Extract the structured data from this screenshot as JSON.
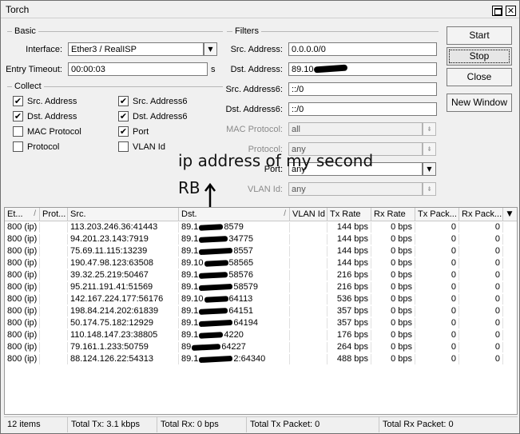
{
  "window": {
    "title": "Torch"
  },
  "basic": {
    "title": "Basic",
    "interface_label": "Interface:",
    "interface_value": "Ether3 / RealISP",
    "timeout_label": "Entry Timeout:",
    "timeout_value": "00:00:03",
    "timeout_unit": "s"
  },
  "collect": {
    "title": "Collect",
    "items": [
      {
        "label": "Src. Address",
        "checked": true
      },
      {
        "label": "Src. Address6",
        "checked": true
      },
      {
        "label": "Dst. Address",
        "checked": true
      },
      {
        "label": "Dst. Address6",
        "checked": true
      },
      {
        "label": "MAC Protocol",
        "checked": false
      },
      {
        "label": "Port",
        "checked": true
      },
      {
        "label": "Protocol",
        "checked": false
      },
      {
        "label": "VLAN Id",
        "checked": false
      }
    ],
    "check_mark": "✔"
  },
  "filters": {
    "title": "Filters",
    "src_label": "Src. Address:",
    "src_value": "0.0.0.0/0",
    "dst_label": "Dst. Address:",
    "dst_value": "89.10",
    "src6_label": "Src. Address6:",
    "src6_value": "::/0",
    "dst6_label": "Dst. Address6:",
    "dst6_value": "::/0",
    "mac_label": "MAC Protocol:",
    "mac_value": "all",
    "protocol_label": "Protocol:",
    "protocol_value": "any",
    "port_label": "Port:",
    "port_value": "any",
    "vlan_label": "VLAN Id:",
    "vlan_value": "any"
  },
  "buttons": {
    "start": "Start",
    "stop": "Stop",
    "close": "Close",
    "new_window": "New Window"
  },
  "annotation": {
    "line1": "ip address of my second",
    "line2": "RB"
  },
  "table": {
    "columns": [
      "Et...",
      "Prot...",
      "Src.",
      "Dst.",
      "VLAN Id",
      "Tx Rate",
      "Rx Rate",
      "Tx Pack...",
      "Rx Pack..."
    ],
    "rows": [
      [
        "800 (ip)",
        "",
        "113.203.246.36:41443",
        "89.1",
        "8579",
        "",
        "144 bps",
        "0 bps",
        "0",
        "0"
      ],
      [
        "800 (ip)",
        "",
        "94.201.23.143:7919",
        "89.1",
        "34775",
        "",
        "144 bps",
        "0 bps",
        "0",
        "0"
      ],
      [
        "800 (ip)",
        "",
        "75.69.11.115:13239",
        "89.1",
        "8557",
        "",
        "144 bps",
        "0 bps",
        "0",
        "0"
      ],
      [
        "800 (ip)",
        "",
        "190.47.98.123:63508",
        "89.10",
        "58565",
        "",
        "144 bps",
        "0 bps",
        "0",
        "0"
      ],
      [
        "800 (ip)",
        "",
        "39.32.25.219:50467",
        "89.1",
        "58576",
        "",
        "216 bps",
        "0 bps",
        "0",
        "0"
      ],
      [
        "800 (ip)",
        "",
        "95.211.191.41:51569",
        "89.1",
        "58579",
        "",
        "216 bps",
        "0 bps",
        "0",
        "0"
      ],
      [
        "800 (ip)",
        "",
        "142.167.224.177:56176",
        "89.10",
        "64113",
        "",
        "536 bps",
        "0 bps",
        "0",
        "0"
      ],
      [
        "800 (ip)",
        "",
        "198.84.214.202:61839",
        "89.1",
        "64151",
        "",
        "357 bps",
        "0 bps",
        "0",
        "0"
      ],
      [
        "800 (ip)",
        "",
        "50.174.75.182:12929",
        "89.1",
        "64194",
        "",
        "357 bps",
        "0 bps",
        "0",
        "0"
      ],
      [
        "800 (ip)",
        "",
        "110.148.147.23:38805",
        "89.1",
        "4220",
        "",
        "176 bps",
        "0 bps",
        "0",
        "0"
      ],
      [
        "800 (ip)",
        "",
        "79.161.1.233:50759",
        "89",
        "64227",
        "",
        "264 bps",
        "0 bps",
        "0",
        "0"
      ],
      [
        "800 (ip)",
        "",
        "88.124.126.22:54313",
        "89.1",
        "2:64340",
        "",
        "488 bps",
        "0 bps",
        "0",
        "0"
      ]
    ]
  },
  "status": {
    "items": "12 items",
    "total_tx": "Total Tx: 3.1 kbps",
    "total_rx": "Total Rx: 0 bps",
    "total_tx_packet": "Total Tx Packet: 0",
    "total_rx_packet": "Total Rx Packet: 0"
  },
  "icons": {
    "dropdown": "▼",
    "disabled_dropdown": "⇟",
    "close": "✕",
    "sort": "/",
    "menu": "▼",
    "arrow_up": "▲"
  }
}
